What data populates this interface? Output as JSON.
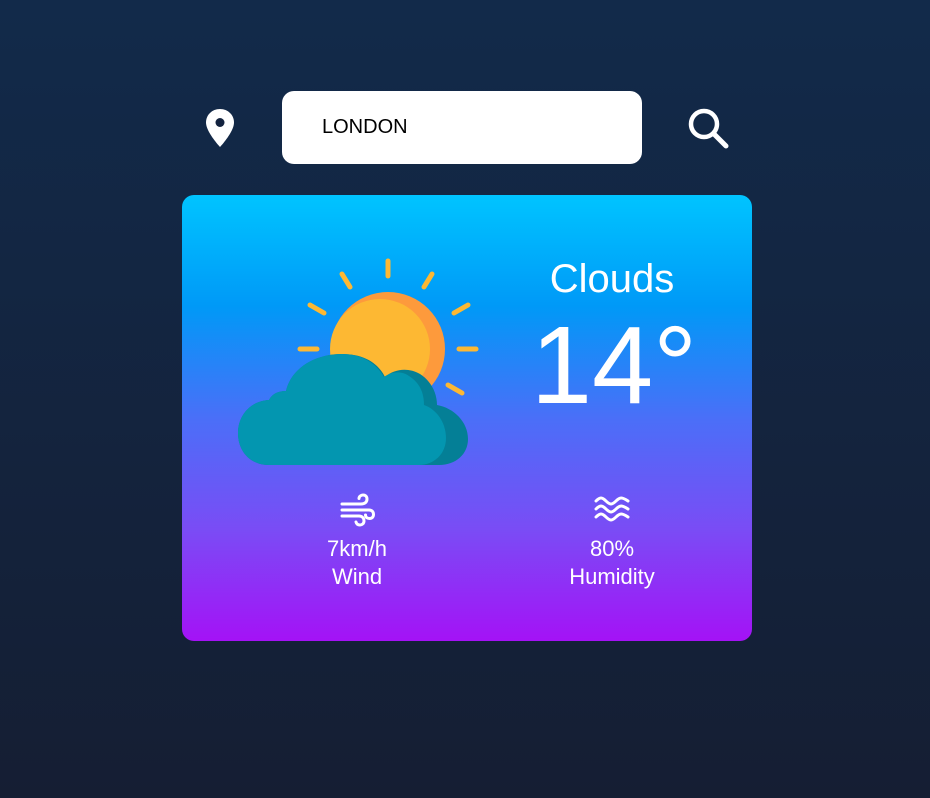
{
  "search": {
    "value": "LONDON",
    "location_icon": "map-pin-icon",
    "search_icon": "magnifier-icon"
  },
  "weather": {
    "icon": "sun-behind-cloud-icon",
    "condition": "Clouds",
    "temperature": "14°"
  },
  "stats": {
    "wind": {
      "icon": "wind-icon",
      "value": "7km/h",
      "label": "Wind"
    },
    "humidity": {
      "icon": "water-waves-icon",
      "value": "80%",
      "label": "Humidity"
    }
  },
  "colors": {
    "background_top": "#122a4a",
    "background_bottom": "#151e33",
    "card_top": "#00c4ff",
    "card_bottom": "#a412f6",
    "sun": "#fdb833",
    "sun_shade": "#fd9a3c",
    "cloud": "#0396b0",
    "cloud_shade": "#047f96"
  }
}
